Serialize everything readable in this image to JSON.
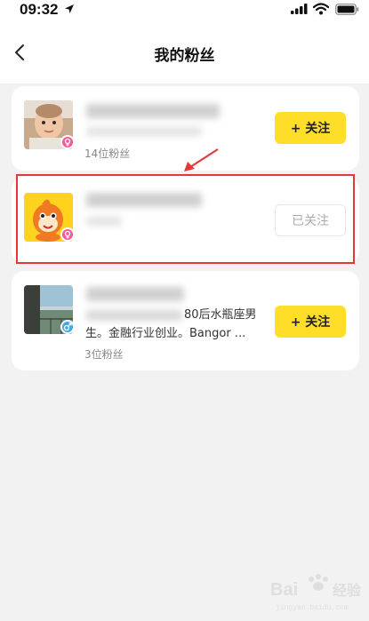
{
  "status_bar": {
    "time": "09:32"
  },
  "nav": {
    "title": "我的粉丝"
  },
  "fans": [
    {
      "fans_count": "14位粉丝",
      "button_label": "+ 关注",
      "following": false,
      "gender": "female"
    },
    {
      "button_label": "已关注",
      "following": true,
      "gender": "female"
    },
    {
      "bio_line1": "80后水瓶座男",
      "bio_line2": "生。金融行业创业。Bangor ...",
      "fans_count": "3位粉丝",
      "button_label": "+ 关注",
      "following": false,
      "gender": "male"
    }
  ],
  "watermark": {
    "text": "Bai经验"
  },
  "colors": {
    "accent": "#ffde2a",
    "highlight": "#e23a3a",
    "female": "#f25a98",
    "male": "#3ea8ee"
  }
}
